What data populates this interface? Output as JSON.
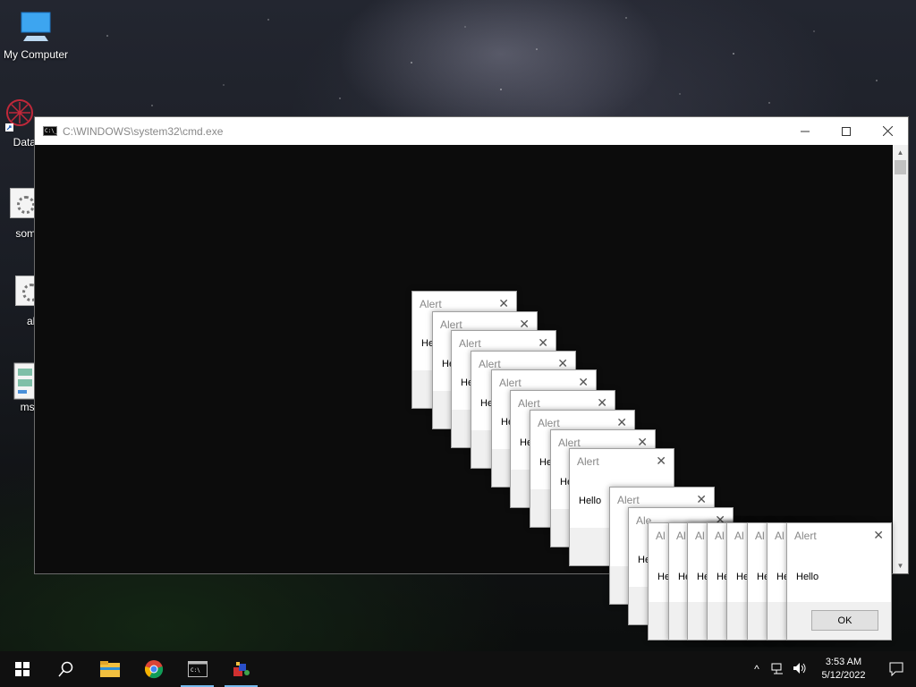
{
  "desktop": {
    "icons": [
      {
        "label": "My Computer",
        "icon": "monitor-icon"
      },
      {
        "label": "DataW",
        "icon": "datawrapper-icon"
      },
      {
        "label": "some",
        "icon": "exe-icon"
      },
      {
        "label": "ale",
        "icon": "exe-icon"
      },
      {
        "label": "msg",
        "icon": "script-icon"
      }
    ]
  },
  "cmd": {
    "title": "C:\\WINDOWS\\system32\\cmd.exe"
  },
  "alerts": {
    "title": "Alert",
    "title_truncated": "Ale",
    "title_short": "Al",
    "message": "Hello",
    "message_truncated": "He",
    "ok_label": "OK"
  },
  "taskbar": {
    "items": [
      "windows-start-icon",
      "search-icon",
      "file-explorer-icon",
      "chrome-icon",
      "cmd-icon",
      "app-icon"
    ],
    "time": "3:53 AM",
    "date": "5/12/2022"
  }
}
